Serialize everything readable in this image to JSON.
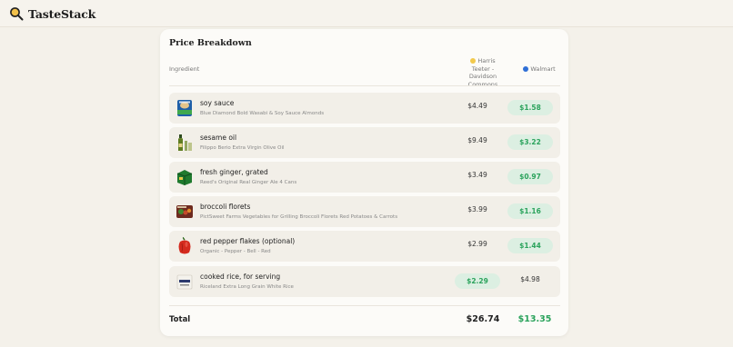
{
  "app": {
    "name": "TasteStack"
  },
  "breakdown": {
    "title": "Price Breakdown",
    "columns": {
      "ingredient": "Ingredient",
      "store1": "Harris Teeter - Davidson Commons",
      "store2": "Walmart"
    },
    "store_colors": {
      "store1": "#f2c94c",
      "store2": "#2f6fd6"
    },
    "rows": [
      {
        "name": "soy sauce",
        "product": "Blue Diamond Bold Wasabi & Soy Sauce Almonds",
        "price1": "$4.49",
        "price2": "$1.58",
        "cheaper": "store2",
        "icon": "almond-can-icon"
      },
      {
        "name": "sesame oil",
        "product": "Filippo Berio Extra Virgin Olive Oil",
        "price1": "$9.49",
        "price2": "$3.22",
        "cheaper": "store2",
        "icon": "oil-bottle-icon"
      },
      {
        "name": "fresh ginger, grated",
        "product": "Reed's Original Real Ginger Ale 4 Cans",
        "price1": "$3.49",
        "price2": "$0.97",
        "cheaper": "store2",
        "icon": "ginger-ale-pack-icon"
      },
      {
        "name": "broccoli florets",
        "product": "PictSweet Farms Vegetables for Grilling Broccoli Florets Red Potatoes & Carrots",
        "price1": "$3.99",
        "price2": "$1.16",
        "cheaper": "store2",
        "icon": "vegetable-bag-icon"
      },
      {
        "name": "red pepper flakes (optional)",
        "product": "Organic - Pepper - Bell - Red",
        "price1": "$2.99",
        "price2": "$1.44",
        "cheaper": "store2",
        "icon": "red-pepper-icon"
      },
      {
        "name": "cooked rice, for serving",
        "product": "Riceland Extra Long Grain White Rice",
        "price1": "$2.29",
        "price2": "$4.98",
        "cheaper": "store1",
        "icon": "rice-bag-icon"
      }
    ],
    "total": {
      "label": "Total",
      "store1": "$26.74",
      "store2": "$13.35"
    }
  }
}
